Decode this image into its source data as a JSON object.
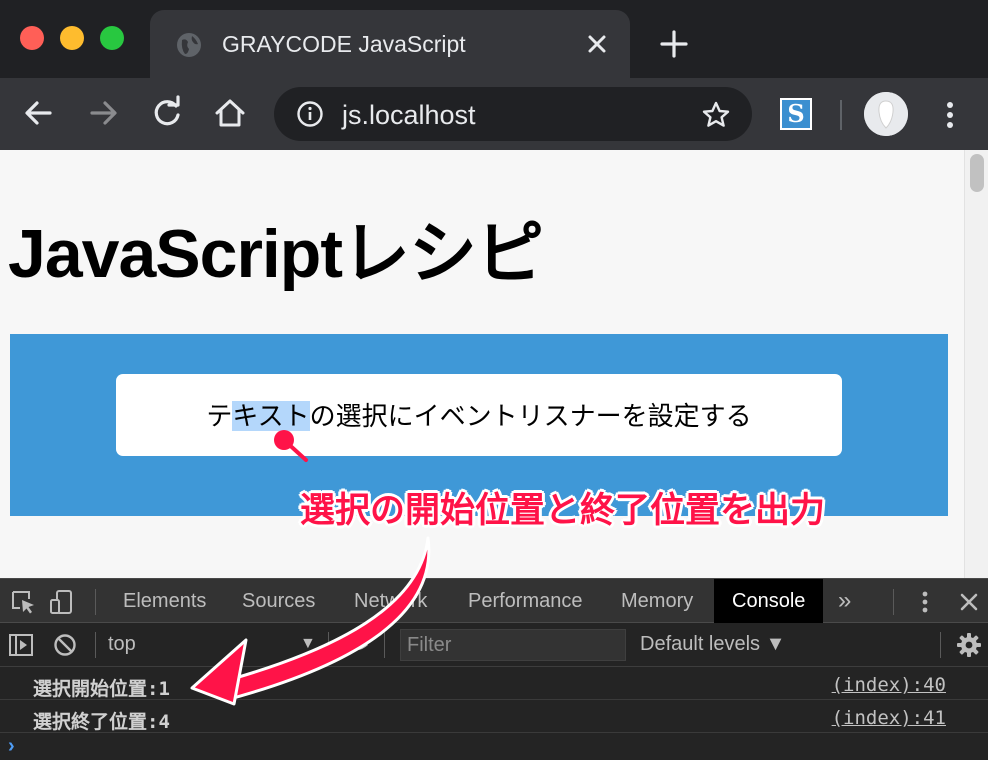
{
  "window": {
    "tab": {
      "title": "GRAYCODE JavaScript",
      "favicon_icon": "globe-icon"
    }
  },
  "toolbar": {
    "url": "js.localhost"
  },
  "page": {
    "title": "JavaScriptレシピ",
    "textbox": {
      "before": "テ",
      "selected": "キスト",
      "after": "の選択にイベントリスナーを設定する"
    },
    "callout": "選択の開始位置と終了位置を出力"
  },
  "devtools": {
    "tabs": [
      "Elements",
      "Sources",
      "Network",
      "Performance",
      "Memory",
      "Console"
    ],
    "active_tab": "Console",
    "more": "»",
    "context": "top",
    "filter_placeholder": "Filter",
    "levels": "Default levels ▼",
    "logs": [
      {
        "message": "選択開始位置:1",
        "source": "(index):40"
      },
      {
        "message": "選択終了位置:4",
        "source": "(index):41"
      }
    ],
    "prompt": "›"
  },
  "colors": {
    "callout": "#ff1348",
    "banner": "#3f98d7",
    "selection": "#b4d7fb"
  }
}
